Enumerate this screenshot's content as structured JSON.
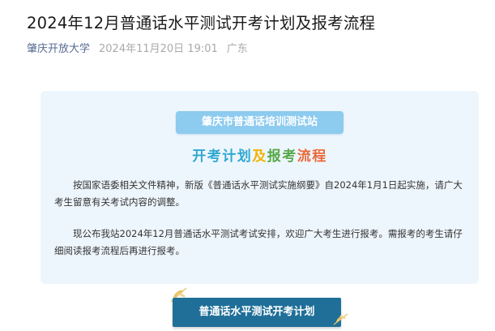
{
  "article": {
    "title": "2024年12月普通话水平测试开考计划及报考流程",
    "account": "肇庆开放大学",
    "date": "2024年11月20日 19:01",
    "location": "广东"
  },
  "card": {
    "station_name": "肇庆市普通话培训测试站",
    "heading_parts": [
      "开考计划",
      "及",
      "报考",
      "流程"
    ],
    "heading_colors": [
      "#2fa8cf",
      "#f0b400",
      "#55a84a",
      "#e96a3b"
    ],
    "paragraph1": "按国家语委相关文件精神，新版《普通话水平测试实施纲要》自2024年1月1日起实施，请广大考生留意有关考试内容的调整。",
    "paragraph2": "现公布我站2024年12月普通话水平测试考试安排，欢迎广大考生进行报考。需报考的考生请仔细阅读报考流程后再进行报考。"
  },
  "button": {
    "label": "普通话水平测试开考计划"
  },
  "decorations": {
    "leaf_icon": "leaf-sprig-icon",
    "leaf_color": "#e9c46a"
  }
}
